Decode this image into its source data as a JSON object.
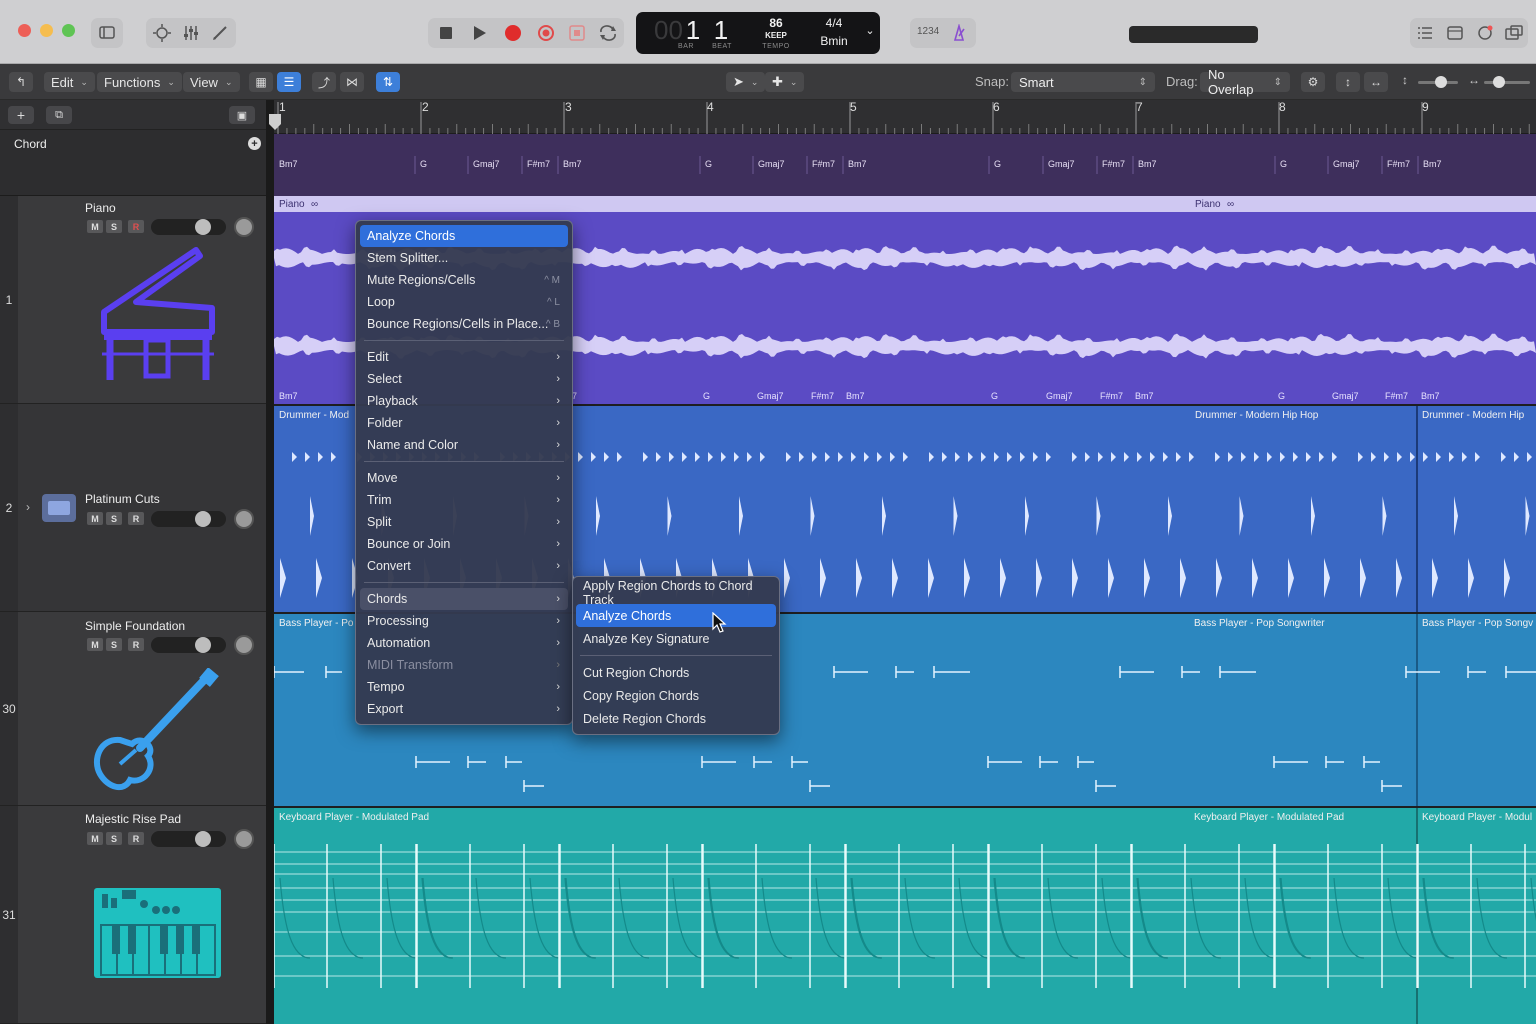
{
  "titlebar": {
    "lcd": {
      "bar": "1",
      "beat": "1",
      "bar_label": "BAR",
      "beat_label": "BEAT",
      "tempo": "86",
      "tempo_mode": "KEEP",
      "tempo_label": "TEMPO",
      "signature": "4/4",
      "key": "Bmin"
    },
    "count_in": "1234"
  },
  "toolbar": {
    "edit": "Edit",
    "functions": "Functions",
    "view": "View",
    "snap_label": "Snap:",
    "snap_value": "Smart",
    "drag_label": "Drag:",
    "drag_value": "No Overlap"
  },
  "ruler": {
    "bars": [
      "1",
      "2",
      "3",
      "4",
      "5",
      "6",
      "7",
      "8",
      "9"
    ]
  },
  "chord_track": {
    "name": "Chord",
    "chords": [
      "Bm7",
      "G",
      "Gmaj7",
      "F#m7",
      "Bm7",
      "G",
      "Gmaj7",
      "F#m7",
      "Bm7",
      "G",
      "Gmaj7",
      "F#m7",
      "Bm7",
      "G",
      "Gmaj7",
      "F#m7",
      "Bm7"
    ]
  },
  "tracks": [
    {
      "number": "1",
      "name": "Piano",
      "color": "#5a4bc7",
      "icon": "piano-icon"
    },
    {
      "number": "2",
      "name": "Platinum Cuts",
      "color": "#3868c6",
      "icon": "drummer-icon"
    },
    {
      "number": "30",
      "name": "Simple Foundation",
      "color": "#2e86c1",
      "icon": "bass-guitar-icon"
    },
    {
      "number": "31",
      "name": "Majestic Rise Pad",
      "color": "#1fb0b0",
      "icon": "synth-keyboard-icon"
    }
  ],
  "track_buttons": {
    "mute": "M",
    "solo": "S",
    "record": "R"
  },
  "regions": {
    "piano_a": "Piano",
    "piano_b": "Piano",
    "piano_chords": [
      "Bm7",
      "7",
      "G",
      "Gmaj7",
      "F#m7",
      "Bm7",
      "G",
      "Gmaj7",
      "F#m7",
      "Bm7",
      "G",
      "Gmaj7",
      "F#m7",
      "Bm7"
    ],
    "drummer_a": "Drummer - Mod",
    "drummer_b": "Drummer - Modern Hip Hop",
    "drummer_c": "Drummer - Modern Hip",
    "bass_a": "Bass Player - Po",
    "bass_b": "Bass Player - Pop Songwriter",
    "bass_c": "Bass Player - Pop Songv",
    "keys_a": "Keyboard Player - Modulated Pad",
    "keys_b": "Keyboard Player - Modulated Pad",
    "keys_c": "Keyboard Player - Modul"
  },
  "context_menu": {
    "items": [
      {
        "label": "Analyze Chords",
        "highlighted": true
      },
      {
        "label": "Stem Splitter..."
      },
      {
        "label": "Mute Regions/Cells",
        "shortcut": "^ M"
      },
      {
        "label": "Loop",
        "shortcut": "^ L"
      },
      {
        "label": "Bounce Regions/Cells in Place...",
        "shortcut": "^ B"
      },
      {
        "label": "Edit",
        "sub": true
      },
      {
        "label": "Select",
        "sub": true
      },
      {
        "label": "Playback",
        "sub": true
      },
      {
        "label": "Folder",
        "sub": true
      },
      {
        "label": "Name and Color",
        "sub": true
      },
      {
        "label": "Move",
        "sub": true
      },
      {
        "label": "Trim",
        "sub": true
      },
      {
        "label": "Split",
        "sub": true
      },
      {
        "label": "Bounce or Join",
        "sub": true
      },
      {
        "label": "Convert",
        "sub": true
      },
      {
        "label": "Chords",
        "sub": true,
        "open": true
      },
      {
        "label": "Processing",
        "sub": true
      },
      {
        "label": "Automation",
        "sub": true
      },
      {
        "label": "MIDI Transform",
        "sub": true,
        "disabled": true
      },
      {
        "label": "Tempo",
        "sub": true
      },
      {
        "label": "Export",
        "sub": true
      }
    ]
  },
  "chords_submenu": {
    "items": [
      {
        "label": "Apply Region Chords to Chord Track"
      },
      {
        "label": "Analyze Chords",
        "highlighted": true
      },
      {
        "label": "Analyze Key Signature"
      },
      {
        "label": "Cut Region Chords"
      },
      {
        "label": "Copy Region Chords"
      },
      {
        "label": "Delete Region Chords"
      }
    ]
  }
}
